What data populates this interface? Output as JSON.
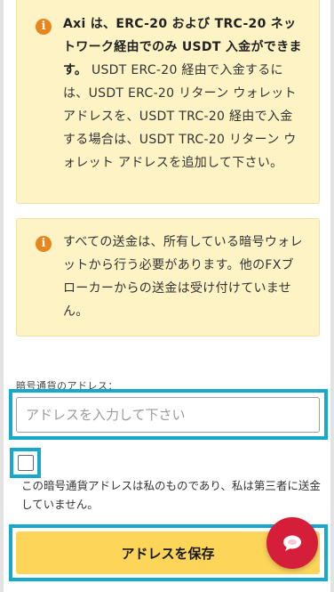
{
  "notices": [
    {
      "bold": "Axi は、ERC-20 および TRC-20 ネットワーク経由でのみ USDT 入金ができます。",
      "text": " USDT ERC-20 経由で入金するには、USDT ERC-20 リターン ウォレット アドレスを、USDT TRC-20 経由で入金する場合は、USDT TRC-20 リターン ウォレット アドレスを追加して下さい。"
    },
    {
      "text": "すべての送金は、所有している暗号ウォレットから行う必要があります。他のFXブローカーからの送金は受け付けていません。"
    }
  ],
  "form": {
    "address_label": "暗号通貨のアドレス：",
    "address_placeholder": "アドレスを入力して下さい",
    "address_value": "",
    "checkbox_checked": false,
    "checkbox_label": "この暗号通貨アドレスは私のものであり、私は第三者に送金していません。",
    "save_button": "アドレスを保存"
  },
  "colors": {
    "notice_bg": "#fdf3c5",
    "info_icon": "#e8851c",
    "highlight": "#16a9cc",
    "save_button": "#fdd559",
    "chat_button": "#d51f3a"
  },
  "icons": {
    "notice": "info-icon",
    "chat": "chat-bubble-icon"
  }
}
